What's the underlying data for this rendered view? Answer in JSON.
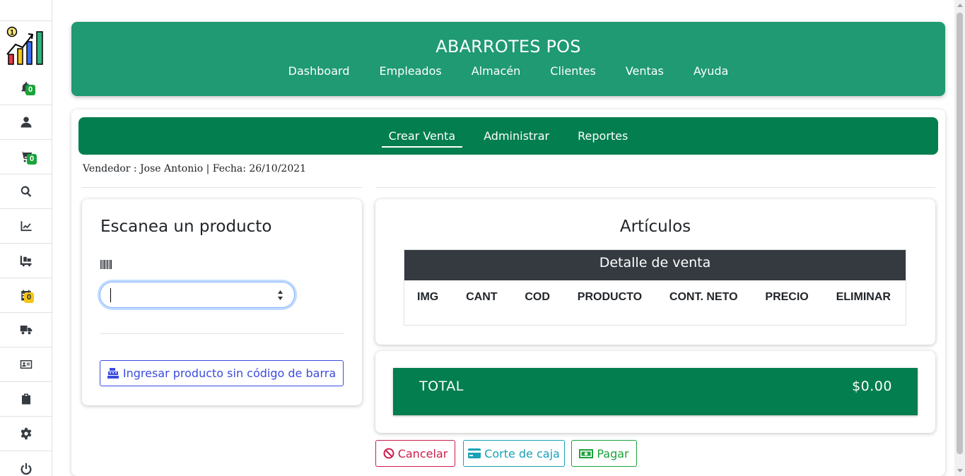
{
  "app": {
    "title": "ABARROTES POS"
  },
  "header": {
    "nav": [
      "Dashboard",
      "Empleados",
      "Almacén",
      "Clientes",
      "Ventas",
      "Ayuda"
    ]
  },
  "sidebar": {
    "items": [
      {
        "icon": "bell-icon",
        "badge": "0",
        "badge_color": "#1ba33a"
      },
      {
        "icon": "user-icon"
      },
      {
        "icon": "cart-icon",
        "badge": "0",
        "badge_color": "#1ba33a"
      },
      {
        "icon": "search-icon"
      },
      {
        "icon": "chart-line-icon"
      },
      {
        "icon": "dolly-icon"
      },
      {
        "icon": "calendar-icon",
        "badge": "0",
        "badge_color": "#f5c518"
      },
      {
        "icon": "truck-icon"
      },
      {
        "icon": "id-card-icon"
      },
      {
        "icon": "clipboard-icon"
      },
      {
        "icon": "gear-icon"
      },
      {
        "icon": "power-icon"
      }
    ],
    "logo_badge": "1"
  },
  "subnav": {
    "tabs": [
      "Crear Venta",
      "Administrar",
      "Reportes"
    ],
    "active": "Crear Venta"
  },
  "vendor_line": "Vendedor : Jose Antonio | Fecha: 26/10/2021",
  "scan": {
    "title": "Escanea un producto",
    "input_value": "",
    "button_label": "Ingresar producto sin código de barra"
  },
  "articles": {
    "title": "Artículos",
    "table_title": "Detalle de venta",
    "columns": [
      "IMG",
      "CANT",
      "COD",
      "PRODUCTO",
      "CONT. NETO",
      "PRECIO",
      "ELIMINAR"
    ],
    "rows": []
  },
  "total": {
    "label": "TOTAL",
    "value": "$0.00"
  },
  "actions": {
    "cancel": "Cancelar",
    "corte": "Corte de caja",
    "pagar": "Pagar"
  },
  "colors": {
    "header_green": "#1f9a73",
    "subnav_green": "#027e4f",
    "cancel_red": "#cc1d4b",
    "info_teal": "#17a2b8",
    "success_green": "#1ba33a",
    "primary_blue": "#3b4cdf"
  }
}
